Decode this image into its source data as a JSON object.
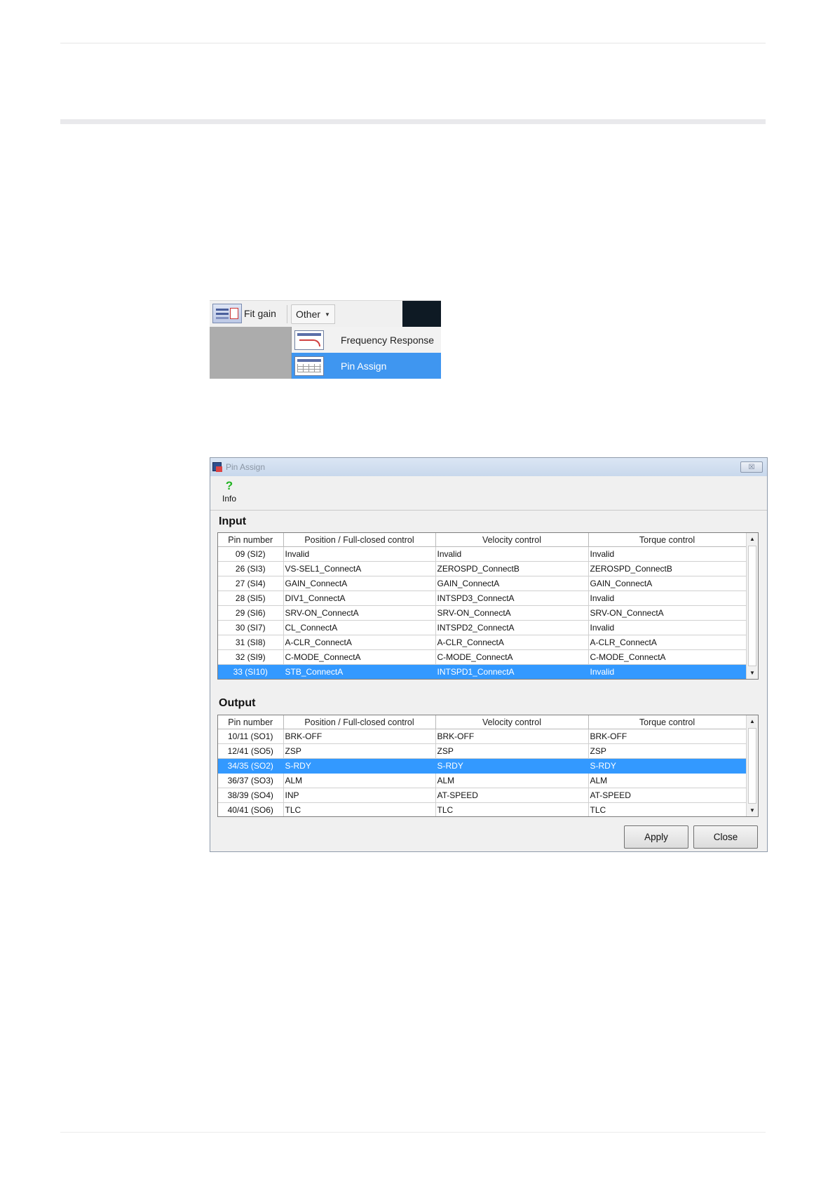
{
  "menu": {
    "fit_gain_label": "Fit gain",
    "other_label": "Other",
    "items": [
      {
        "label": "Frequency Response",
        "icon": "frequency-response-icon",
        "selected": false
      },
      {
        "label": "Pin Assign",
        "icon": "pin-assign-icon",
        "selected": true
      }
    ]
  },
  "window": {
    "title": "Pin Assign",
    "close_glyph": "☒",
    "info_glyph": "?",
    "info_label": "Info",
    "input_label": "Input",
    "output_label": "Output",
    "columns": [
      "Pin number",
      "Position / Full-closed control",
      "Velocity control",
      "Torque control"
    ],
    "input_rows": [
      [
        "09 (SI2)",
        "Invalid",
        "Invalid",
        "Invalid"
      ],
      [
        "26 (SI3)",
        "VS-SEL1_ConnectA",
        "ZEROSPD_ConnectB",
        "ZEROSPD_ConnectB"
      ],
      [
        "27 (SI4)",
        "GAIN_ConnectA",
        "GAIN_ConnectA",
        "GAIN_ConnectA"
      ],
      [
        "28 (SI5)",
        "DIV1_ConnectA",
        "INTSPD3_ConnectA",
        "Invalid"
      ],
      [
        "29 (SI6)",
        "SRV-ON_ConnectA",
        "SRV-ON_ConnectA",
        "SRV-ON_ConnectA"
      ],
      [
        "30 (SI7)",
        "CL_ConnectA",
        "INTSPD2_ConnectA",
        "Invalid"
      ],
      [
        "31 (SI8)",
        "A-CLR_ConnectA",
        "A-CLR_ConnectA",
        "A-CLR_ConnectA"
      ],
      [
        "32 (SI9)",
        "C-MODE_ConnectA",
        "C-MODE_ConnectA",
        "C-MODE_ConnectA"
      ],
      [
        "33 (SI10)",
        "STB_ConnectA",
        "INTSPD1_ConnectA",
        "Invalid"
      ]
    ],
    "input_selected_index": 8,
    "output_rows": [
      [
        "10/11 (SO1)",
        "BRK-OFF",
        "BRK-OFF",
        "BRK-OFF"
      ],
      [
        "12/41 (SO5)",
        "ZSP",
        "ZSP",
        "ZSP"
      ],
      [
        "34/35 (SO2)",
        "S-RDY",
        "S-RDY",
        "S-RDY"
      ],
      [
        "36/37 (SO3)",
        "ALM",
        "ALM",
        "ALM"
      ],
      [
        "38/39 (SO4)",
        "INP",
        "AT-SPEED",
        "AT-SPEED"
      ],
      [
        "40/41 (SO6)",
        "TLC",
        "TLC",
        "TLC"
      ]
    ],
    "output_selected_index": 2,
    "apply_label": "Apply",
    "close_label": "Close",
    "selection_color": "#3399ff"
  }
}
